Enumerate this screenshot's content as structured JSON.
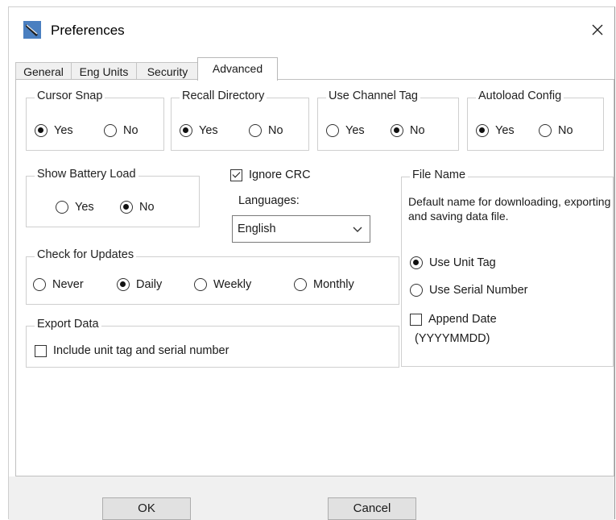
{
  "window": {
    "title": "Preferences",
    "app_icon": "probe-tool-icon",
    "close_icon": "close-icon"
  },
  "tabs": [
    {
      "label": "General",
      "active": false
    },
    {
      "label": "Eng Units",
      "active": false
    },
    {
      "label": "Security",
      "active": false
    },
    {
      "label": "Advanced",
      "active": true
    }
  ],
  "groups": {
    "cursor_snap": {
      "title": "Cursor Snap",
      "options": [
        "Yes",
        "No"
      ],
      "selected": "Yes"
    },
    "recall_directory": {
      "title": "Recall Directory",
      "options": [
        "Yes",
        "No"
      ],
      "selected": "Yes"
    },
    "use_channel_tag": {
      "title": "Use Channel Tag",
      "options": [
        "Yes",
        "No"
      ],
      "selected": "No"
    },
    "autoload_config": {
      "title": "Autoload Config",
      "options": [
        "Yes",
        "No"
      ],
      "selected": "Yes"
    },
    "show_battery_load": {
      "title": "Show Battery Load",
      "options": [
        "Yes",
        "No"
      ],
      "selected": "No"
    },
    "check_for_updates": {
      "title": "Check for Updates",
      "options": [
        "Never",
        "Daily",
        "Weekly",
        "Monthly"
      ],
      "selected": "Daily"
    },
    "export_data": {
      "title": "Export Data",
      "checkbox_label": "Include unit tag and serial number",
      "checked": false
    },
    "file_name": {
      "title": "File Name",
      "description": "Default name for downloading, exporting and saving data file.",
      "options": [
        "Use Unit Tag",
        "Use Serial Number"
      ],
      "selected": "Use Unit Tag",
      "append_date_label": "Append Date",
      "append_date_format": "(YYYYMMDD)",
      "append_date_checked": false
    }
  },
  "ignore_crc": {
    "label": "Ignore CRC",
    "checked": true
  },
  "languages": {
    "label": "Languages:",
    "value": "English"
  },
  "buttons": {
    "ok": "OK",
    "cancel": "Cancel"
  }
}
